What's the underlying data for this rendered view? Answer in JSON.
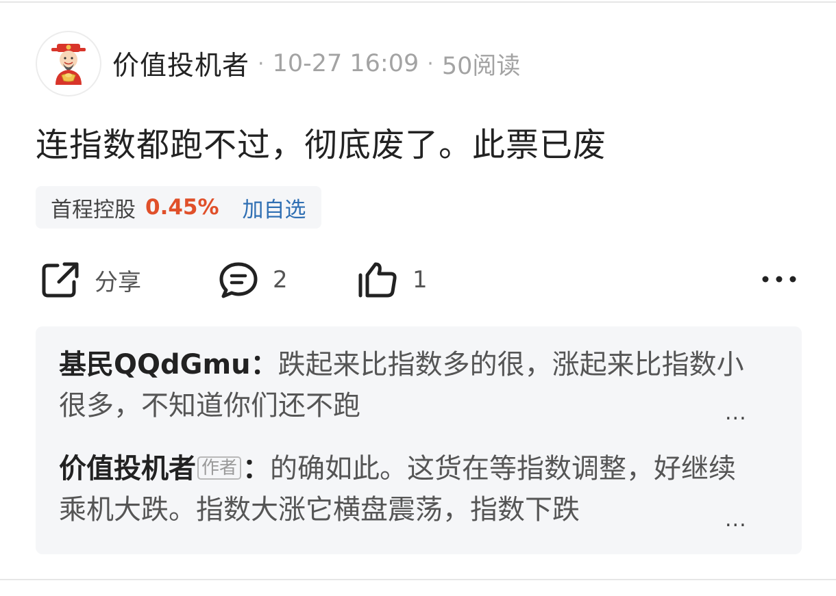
{
  "post": {
    "author": "价值投机者",
    "separator": "·",
    "time": "10-27 16:09",
    "reads": "50阅读",
    "text": "连指数都跑不过，彻底废了。此票已废"
  },
  "stock": {
    "name": "首程控股",
    "change": "0.45%",
    "add_label": "加自选",
    "change_color": "#e0502a",
    "add_color": "#2f6fb3"
  },
  "actions": {
    "share_label": "分享",
    "comment_count": "2",
    "like_count": "1",
    "more_icon": "more-dots-icon"
  },
  "comments": [
    {
      "name": "基民QQdGmu",
      "colon": "：",
      "text": "跌起来比指数多的很，涨起来比指数小很多，不知道你们还不跑",
      "ellipsis": "..."
    },
    {
      "name": "价值投机者",
      "tag": "作者",
      "colon": "：",
      "text": "的确如此。这货在等指数调整，好继续乘机大跌。指数大涨它横盘震荡，指数下跌",
      "ellipsis": "..."
    }
  ]
}
